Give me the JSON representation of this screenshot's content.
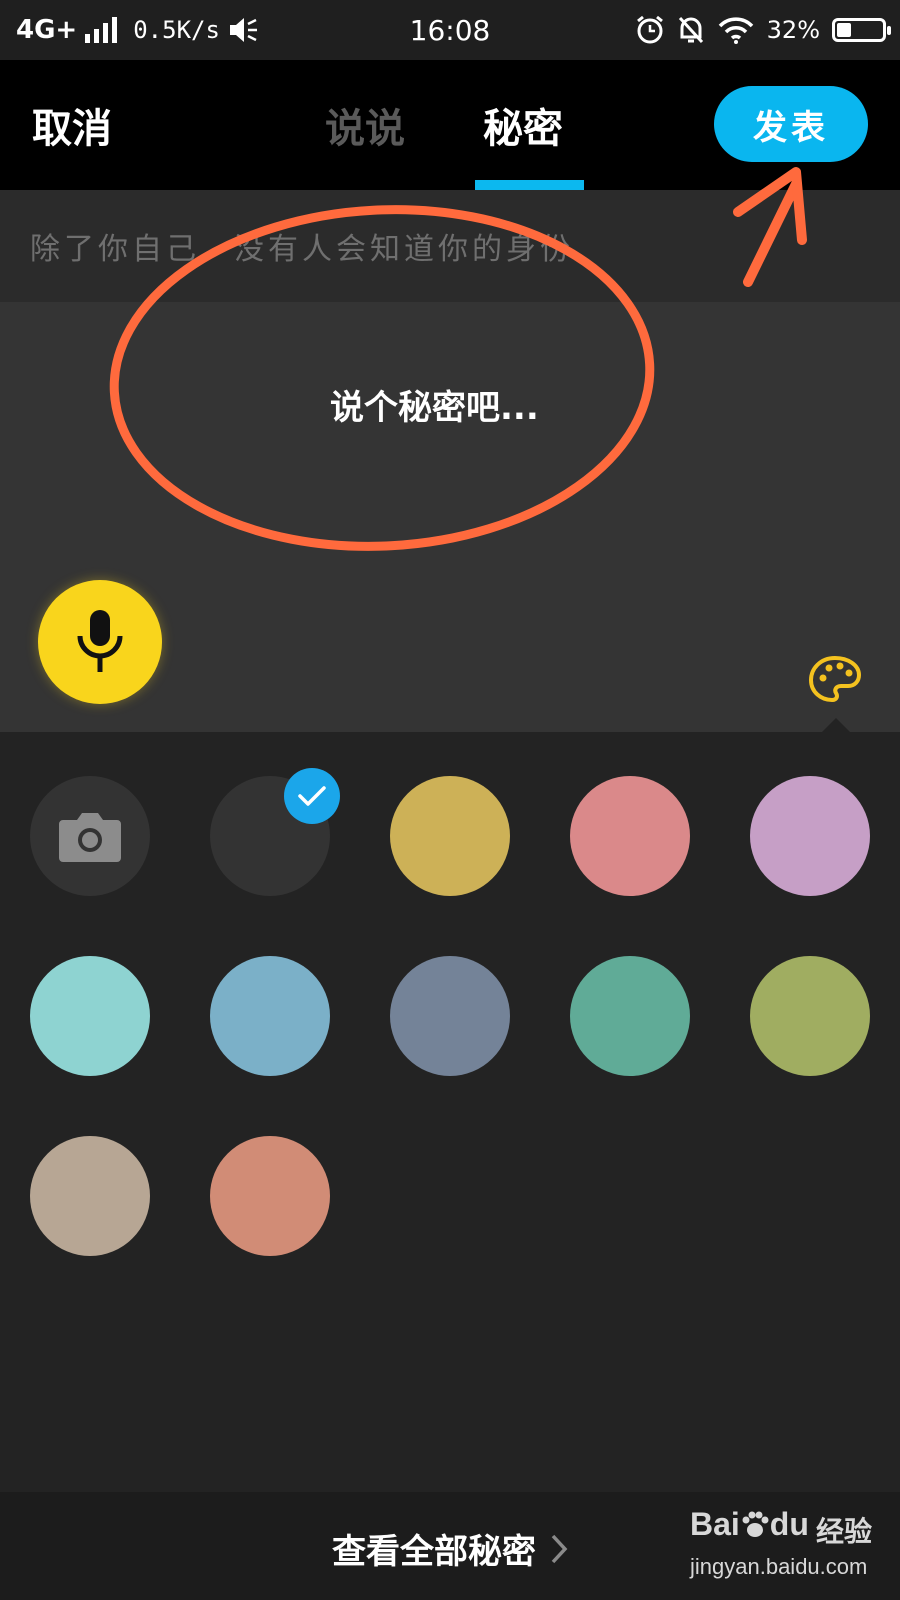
{
  "status_bar": {
    "network": "4G+",
    "speed": "0.5K/s",
    "time": "16:08",
    "battery": "32%",
    "battery_level": 0.32
  },
  "nav": {
    "cancel": "取消",
    "tabs": [
      {
        "label": "说说",
        "active": false
      },
      {
        "label": "秘密",
        "active": true
      }
    ],
    "publish": "发表"
  },
  "hint": "除了你自己，没有人会知道你的身份",
  "compose": {
    "placeholder": "说个秘密吧..."
  },
  "colors": {
    "options": [
      {
        "type": "camera"
      },
      {
        "color": "#333333",
        "selected": true
      },
      {
        "color": "#cdb157"
      },
      {
        "color": "#da898a"
      },
      {
        "color": "#c69fc6"
      },
      {
        "color": "#8ed3d1"
      },
      {
        "color": "#7bb0c8"
      },
      {
        "color": "#748398"
      },
      {
        "color": "#60ab97"
      },
      {
        "color": "#a0ad61"
      },
      {
        "color": "#b7a694"
      },
      {
        "color": "#d18c76"
      }
    ],
    "accent_blue": "#0ab6ef",
    "mic_yellow": "#f9d51c",
    "annotation_orange": "#ff6a3d"
  },
  "bottom": {
    "view_all": "查看全部秘密"
  },
  "watermark": {
    "logo": "Bai",
    "logo_tail": "du",
    "label": "经验",
    "url": "jingyan.baidu.com"
  }
}
